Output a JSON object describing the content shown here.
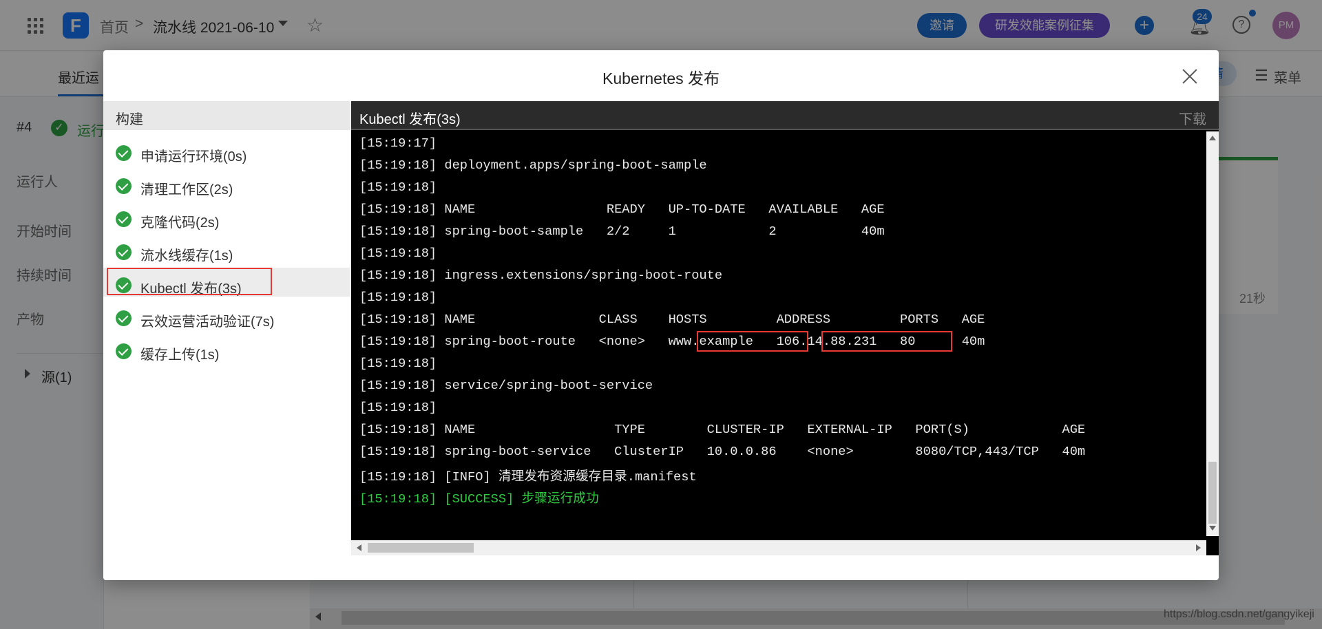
{
  "topbar": {
    "home": "首页",
    "separator": ">",
    "pipeline": "流水线 2021-06-10",
    "invite": "邀请",
    "case_collect": "研发效能案例征集",
    "notifications": "24",
    "avatar": "PM"
  },
  "subbar": {
    "tab_recent": "最近运",
    "menu": "菜单",
    "pill": "情"
  },
  "run": {
    "number": "#4",
    "status": "运行"
  },
  "side": {
    "runner": "运行人",
    "start_time": "开始时间",
    "duration": "持续时间",
    "artifacts": "产物",
    "sources": "源(1)"
  },
  "card": {
    "time": "21秒"
  },
  "watermark": "https://blog.csdn.net/gangyikeji",
  "modal": {
    "title": "Kubernetes 发布",
    "steps_header": "构建",
    "steps": [
      {
        "label": "申请运行环境(0s)"
      },
      {
        "label": "清理工作区(2s)"
      },
      {
        "label": "克隆代码(2s)"
      },
      {
        "label": "流水线缓存(1s)"
      },
      {
        "label": "Kubectl 发布(3s)"
      },
      {
        "label": "云效运营活动验证(7s)"
      },
      {
        "label": "缓存上传(1s)"
      }
    ],
    "log_title": "Kubectl 发布(3s)",
    "download": "下载",
    "log_lines": [
      "[15:19:17]",
      "[15:19:18] deployment.apps/spring-boot-sample",
      "[15:19:18]",
      "[15:19:18] NAME                 READY   UP-TO-DATE   AVAILABLE   AGE",
      "[15:19:18] spring-boot-sample   2/2     1            2           40m",
      "[15:19:18]",
      "[15:19:18] ingress.extensions/spring-boot-route",
      "[15:19:18]",
      "[15:19:18] NAME                CLASS    HOSTS         ADDRESS         PORTS   AGE",
      "[15:19:18] spring-boot-route   <none>   www.example   106.14.88.231   80      40m",
      "[15:19:18]",
      "[15:19:18] service/spring-boot-service",
      "[15:19:18]",
      "[15:19:18] NAME                  TYPE        CLUSTER-IP   EXTERNAL-IP   PORT(S)            AGE",
      "[15:19:18] spring-boot-service   ClusterIP   10.0.0.86    <none>        8080/TCP,443/TCP   40m",
      "[15:19:18] [INFO] 清理发布资源缓存目录.manifest",
      "[15:19:18] [SUCCESS] 步骤运行成功"
    ]
  }
}
